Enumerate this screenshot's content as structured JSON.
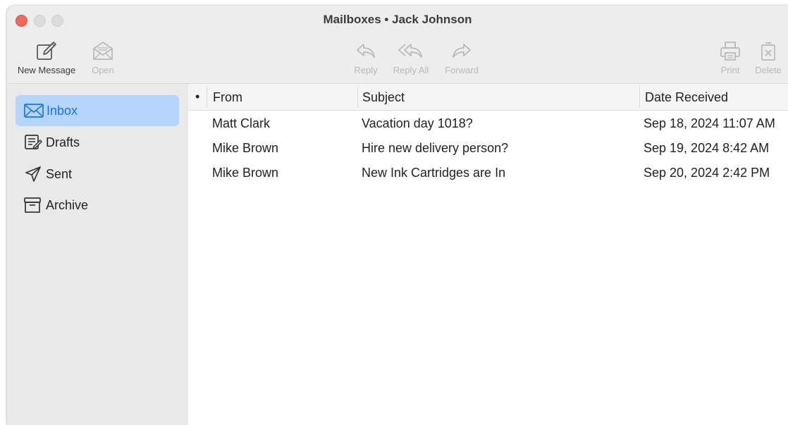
{
  "window": {
    "title": "Mailboxes • Jack Johnson"
  },
  "toolbar": {
    "new_message": "New Message",
    "open": "Open",
    "reply": "Reply",
    "reply_all": "Reply All",
    "forward": "Forward",
    "print": "Print",
    "delete": "Delete"
  },
  "sidebar": {
    "items": [
      {
        "label": "Inbox",
        "icon": "envelope-icon",
        "selected": true
      },
      {
        "label": "Drafts",
        "icon": "drafts-icon",
        "selected": false
      },
      {
        "label": "Sent",
        "icon": "paper-plane-icon",
        "selected": false
      },
      {
        "label": "Archive",
        "icon": "archive-box-icon",
        "selected": false
      }
    ]
  },
  "message_list": {
    "columns": {
      "status": "•",
      "from": "From",
      "subject": "Subject",
      "date": "Date Received"
    },
    "rows": [
      {
        "from": "Matt Clark",
        "subject": "Vacation day 1018?",
        "date": "Sep 18, 2024 11:07 AM"
      },
      {
        "from": "Mike Brown",
        "subject": "Hire new delivery person?",
        "date": "Sep 19, 2024 8:42 AM"
      },
      {
        "from": "Mike Brown",
        "subject": "New Ink Cartridges are In",
        "date": "Sep 20, 2024 2:42 PM"
      }
    ]
  },
  "colors": {
    "selected_bg": "#b4d4fb",
    "accent": "#1a74e8",
    "close_button": "#ec6a5e"
  }
}
